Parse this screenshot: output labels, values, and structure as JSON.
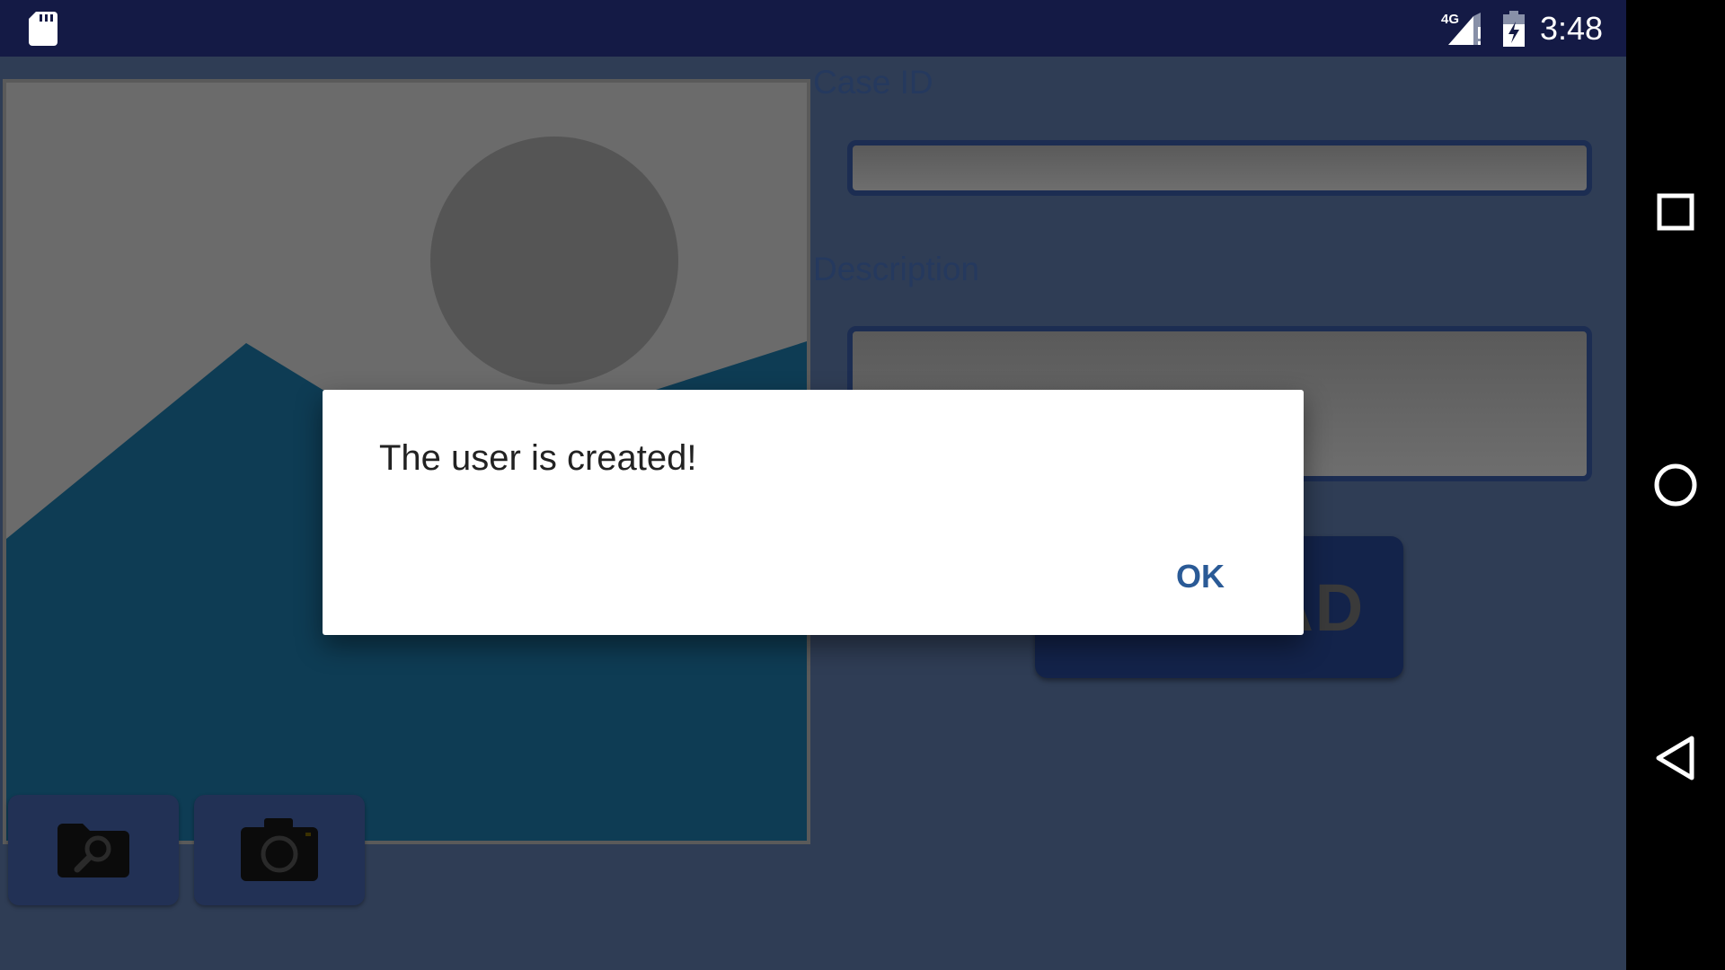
{
  "status_bar": {
    "time": "3:48",
    "network": "4G",
    "icons": [
      "sd-card-icon",
      "signal-icon",
      "battery-icon"
    ]
  },
  "form": {
    "case_id_label": "Case ID",
    "case_id_value": "",
    "description_label": "Description",
    "description_value": "",
    "upload_button_label": "UPLOAD",
    "upload_button_visible_text": "D"
  },
  "image_picker": {
    "placeholder_icon": "image-placeholder-icon",
    "browse_icon": "folder-search-icon",
    "camera_icon": "camera-icon"
  },
  "dialog": {
    "message": "The user is created!",
    "ok_label": "OK"
  },
  "nav_bar": {
    "icons": [
      "recents-icon",
      "home-icon",
      "back-icon"
    ]
  },
  "colors": {
    "status_bar": "#141a45",
    "app_background": "#2f3d55",
    "accent": "#2a5a96",
    "dim_overlay": "#000000"
  }
}
